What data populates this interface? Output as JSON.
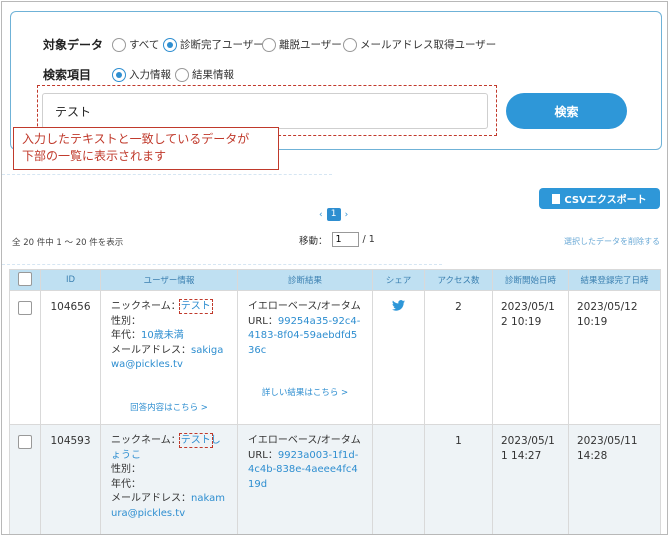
{
  "search": {
    "target_label": "対象データ",
    "target_options": [
      {
        "label": "すべて",
        "selected": false
      },
      {
        "label": "診断完了ユーザー",
        "selected": true
      },
      {
        "label": "離脱ユーザー",
        "selected": false
      },
      {
        "label": "メールアドレス取得ユーザー",
        "selected": false
      }
    ],
    "field_label": "検索項目",
    "field_options": [
      {
        "label": "入力情報",
        "selected": true
      },
      {
        "label": "結果情報",
        "selected": false
      }
    ],
    "query_value": "テスト",
    "search_button": "検索",
    "callout_line1": "入力したテキストと一致しているデータが",
    "callout_line2": "下部の一覧に表示されます"
  },
  "toolbar": {
    "csv_button": "CSVエクスポート",
    "current_page": "1",
    "count_text": "全 20 件中 1 ～ 20 件を表示",
    "jump_label": "移動：",
    "jump_value": "1",
    "jump_total": "/ 1",
    "delete_link": "選択したデータを削除する"
  },
  "table": {
    "headers": [
      "",
      "ID",
      "ユーザー情報",
      "診断結果",
      "シェア",
      "アクセス数",
      "診断開始日時",
      "結果登録完了日時"
    ],
    "rows": [
      {
        "id": "104656",
        "nickname_label": "ニックネーム：",
        "nickname": "テスト",
        "nickname_suffix": "",
        "gender": "性別：",
        "age_label": "年代：",
        "age": "10歳未満",
        "email_label": "メールアドレス：",
        "email": "sakigawa@pickles.tv",
        "answer_link": "回答内容はこちら >",
        "result": "イエローベース/オータム",
        "url_label": "URL：",
        "url": "99254a35-92c4-4183-8f04-59aebdfd536c",
        "detail_link": "詳しい結果はこちら >",
        "share": "twitter",
        "access": "2",
        "start": "2023/05/12 10:19",
        "done": "2023/05/12 10:19"
      },
      {
        "id": "104593",
        "nickname_label": "ニックネーム：",
        "nickname": "テスト",
        "nickname_suffix": "しょうこ",
        "gender": "性別：",
        "age_label": "年代：",
        "age": "",
        "email_label": "メールアドレス：",
        "email": "nakamura@pickles.tv",
        "answer_link": "",
        "result": "イエローベース/オータム",
        "url_label": "URL：",
        "url": "9923a003-1f1d-4c4b-838e-4aeee4fc419d",
        "detail_link": "",
        "share": "",
        "access": "1",
        "start": "2023/05/11 14:27",
        "done": "2023/05/11 14:28"
      }
    ]
  },
  "colors": {
    "accent": "#2e97d8",
    "highlight": "#c0392b",
    "header_bg": "#bfe0f2"
  }
}
